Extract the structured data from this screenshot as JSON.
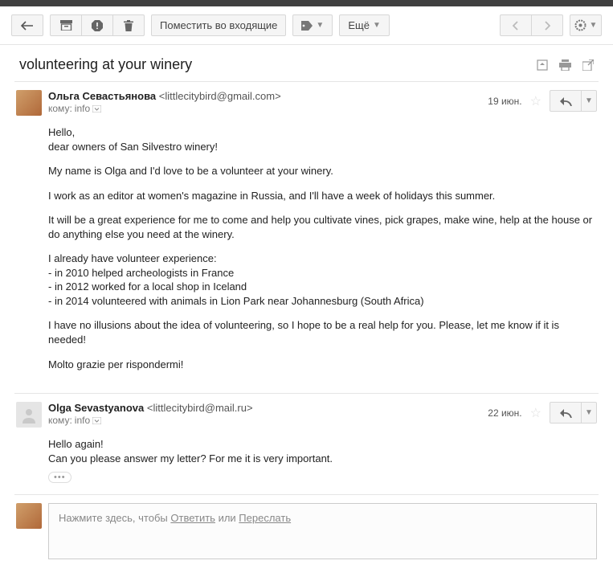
{
  "toolbar": {
    "move_to_inbox": "Поместить во входящие",
    "more": "Ещё"
  },
  "subject": "volunteering at your winery",
  "messages": [
    {
      "sender": "Ольга Севастьянова",
      "email": "<littlecitybird@gmail.com>",
      "to_label": "кому:",
      "to": "info",
      "date": "19 июн.",
      "paragraphs": [
        "Hello,\ndear owners of San Silvestro winery!",
        "My name is Olga and I'd love to be a volunteer at your winery.",
        "I work as an editor at women's magazine in Russia, and I'll have a week of holidays this summer.",
        "It will be a great experience for me to come and help you cultivate vines, pick grapes, make wine, help at the house or do anything else you need at the winery.",
        "I already have volunteer experience:\n- in 2010 helped archeologists in France\n- in 2012 worked for a local shop in Iceland\n- in 2014 volunteered with animals in Lion Park near Johannesburg (South Africa)",
        "I have no illusions about the idea of volunteering, so I hope to be a real help for you. Please, let me know if it is needed!",
        "Molto grazie per rispondermi!"
      ]
    },
    {
      "sender": "Olga Sevastyanova",
      "email": "<littlecitybird@mail.ru>",
      "to_label": "кому:",
      "to": "info",
      "date": "22 июн.",
      "paragraphs": [
        "Hello again!\nCan you please answer my letter? For me it is very important."
      ]
    }
  ],
  "reply": {
    "prefix": "Нажмите здесь, чтобы ",
    "reply": "Ответить",
    "mid": " или ",
    "forward": "Переслать"
  }
}
